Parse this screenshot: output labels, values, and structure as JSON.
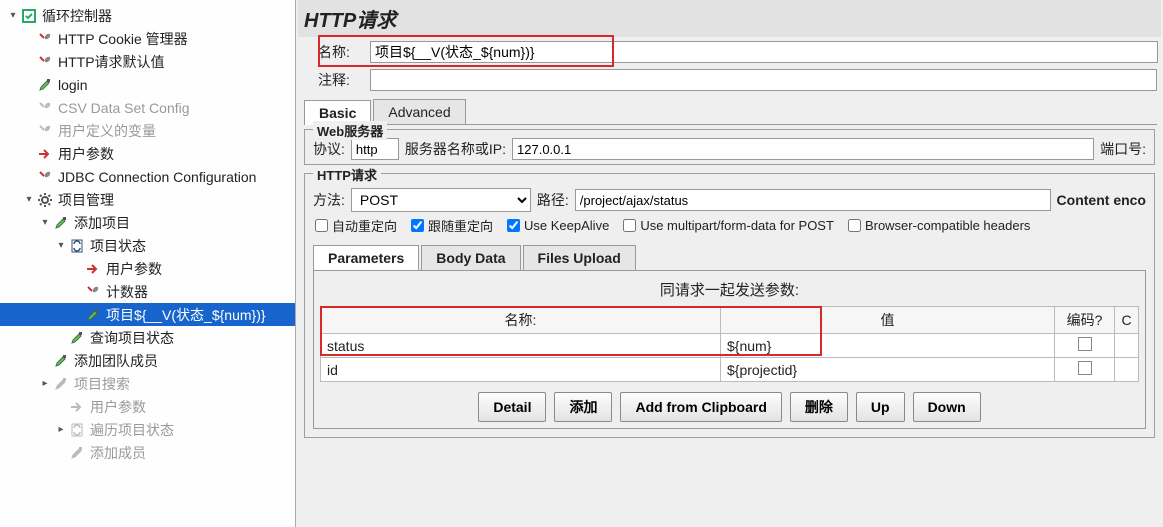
{
  "tree": [
    {
      "label": "循环控制器",
      "icon": "loop",
      "depth": 0,
      "toggle": "open",
      "dim": false
    },
    {
      "label": "HTTP Cookie 管理器",
      "icon": "wrench",
      "depth": 1,
      "dim": false
    },
    {
      "label": "HTTP请求默认值",
      "icon": "wrench",
      "depth": 1,
      "dim": false
    },
    {
      "label": "login",
      "icon": "dropper",
      "depth": 1,
      "dim": false
    },
    {
      "label": "CSV Data Set Config",
      "icon": "wrench",
      "depth": 1,
      "dim": true
    },
    {
      "label": "用户定义的变量",
      "icon": "wrench",
      "depth": 1,
      "dim": true
    },
    {
      "label": "用户参数",
      "icon": "arrow",
      "depth": 1,
      "dim": false
    },
    {
      "label": "JDBC Connection Configuration",
      "icon": "wrench",
      "depth": 1,
      "dim": false
    },
    {
      "label": "项目管理",
      "icon": "gear",
      "depth": 1,
      "toggle": "open",
      "dim": false
    },
    {
      "label": "添加项目",
      "icon": "dropper",
      "depth": 2,
      "toggle": "open",
      "dim": false
    },
    {
      "label": "项目状态",
      "icon": "loopdoc",
      "depth": 3,
      "toggle": "open",
      "dim": false
    },
    {
      "label": "用户参数",
      "icon": "arrow",
      "depth": 4,
      "dim": false
    },
    {
      "label": "计数器",
      "icon": "wrench",
      "depth": 4,
      "dim": false
    },
    {
      "label": "项目${__V(状态_${num})}",
      "icon": "dropper",
      "depth": 4,
      "dim": false,
      "sel": true
    },
    {
      "label": "查询项目状态",
      "icon": "dropper",
      "depth": 3,
      "dim": false
    },
    {
      "label": "添加团队成员",
      "icon": "dropper",
      "depth": 2,
      "dim": false
    },
    {
      "label": "项目搜索",
      "icon": "dropper",
      "depth": 2,
      "toggle": "closed",
      "dim": true
    },
    {
      "label": "用户参数",
      "icon": "arrow",
      "depth": 3,
      "dim": true
    },
    {
      "label": "遍历项目状态",
      "icon": "loopdoc",
      "depth": 3,
      "toggle": "closed",
      "dim": true
    },
    {
      "label": "添加成员",
      "icon": "dropper",
      "depth": 3,
      "dim": true
    }
  ],
  "panel": {
    "title": "HTTP请求",
    "name_label": "名称:",
    "name_value": "项目${__V(状态_${num})}",
    "comment_label": "注释:",
    "comment_value": "",
    "tabs": {
      "basic": "Basic",
      "advanced": "Advanced"
    },
    "web_group": "Web服务器",
    "protocol_label": "协议:",
    "protocol_value": "http",
    "server_label": "服务器名称或IP:",
    "server_value": "127.0.0.1",
    "port_label": "端口号:",
    "http_group": "HTTP请求",
    "method_label": "方法:",
    "method_value": "POST",
    "path_label": "路径:",
    "path_value": "/project/ajax/status",
    "content_enc": "Content enco",
    "cb": {
      "autoredirect": "自动重定向",
      "followredirect": "跟随重定向",
      "keepalive": "Use KeepAlive",
      "multipart": "Use multipart/form-data for POST",
      "browser": "Browser-compatible headers"
    },
    "subtabs": {
      "params": "Parameters",
      "body": "Body Data",
      "files": "Files Upload"
    },
    "params_title": "同请求一起发送参数:",
    "cols": {
      "name": "名称:",
      "value": "值",
      "encode": "编码?",
      "c": "C"
    },
    "rows": [
      {
        "name": "status",
        "value": "${num}"
      },
      {
        "name": "id",
        "value": "${projectid}"
      }
    ],
    "buttons": {
      "detail": "Detail",
      "add": "添加",
      "clipboard": "Add from Clipboard",
      "del": "删除",
      "up": "Up",
      "down": "Down"
    }
  }
}
